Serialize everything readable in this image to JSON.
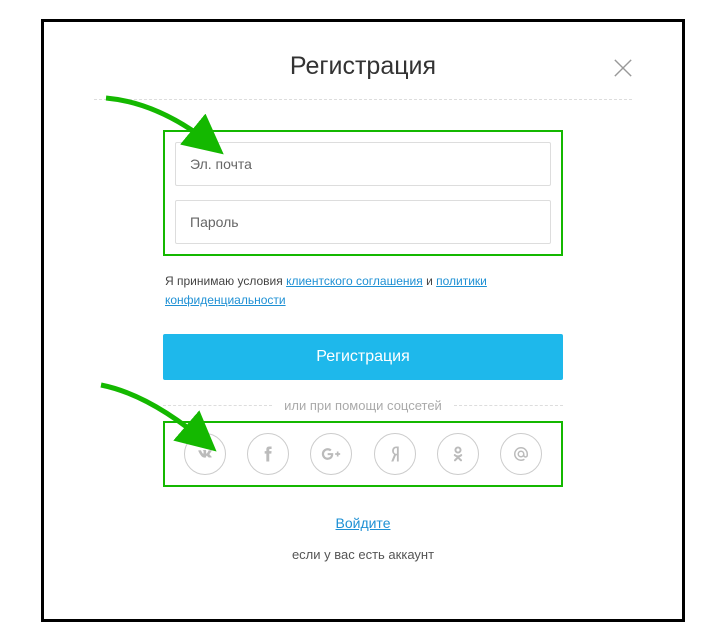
{
  "header": {
    "title": "Регистрация"
  },
  "form": {
    "email_placeholder": "Эл. почта",
    "password_placeholder": "Пароль"
  },
  "terms": {
    "prefix": "Я принимаю условия ",
    "link1": "клиентского соглашения",
    "mid": " и ",
    "link2": "политики конфиденциальности"
  },
  "buttons": {
    "register": "Регистрация"
  },
  "social": {
    "heading": "или при помощи соцсетей"
  },
  "footer": {
    "login_link": "Войдите",
    "have_account": "если у вас есть аккаунт"
  }
}
